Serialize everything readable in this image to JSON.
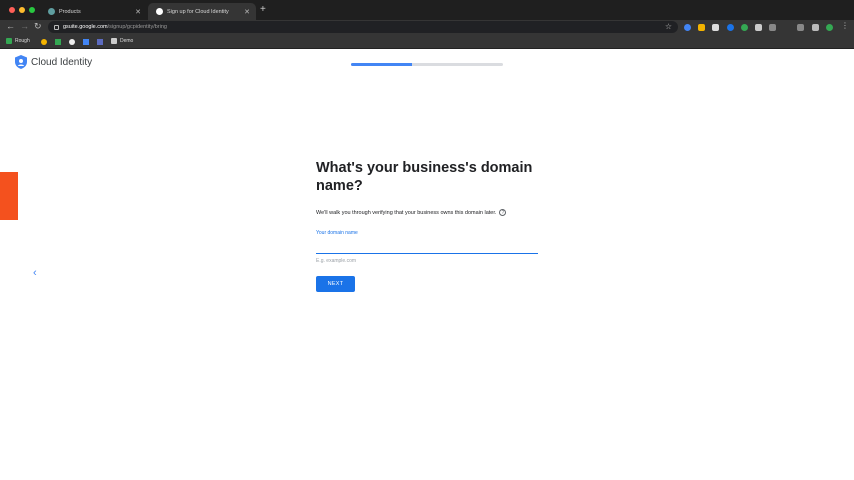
{
  "browser": {
    "tabs": [
      {
        "label": "Products",
        "active": false
      },
      {
        "label": "Sign up for Cloud Identity",
        "active": true
      }
    ],
    "url": {
      "host": "gsuite.google.com",
      "path": "/signup/gcpidentity/bring"
    },
    "bookmarks": [
      "Rough",
      "Demo"
    ]
  },
  "page": {
    "brand": "Cloud Identity",
    "progress_fraction": 0.4,
    "headline": "What's your business's domain name?",
    "description": "We'll walk you through verifying that your business owns this domain later.",
    "help_glyph": "?",
    "field_label": "Your domain name",
    "field_value": "",
    "field_hint": "E.g. example.com",
    "next_label": "NEXT",
    "back_glyph": "‹"
  },
  "colors": {
    "accent": "#1a73e8",
    "progress": "#4285f4",
    "orange_tab": "#f4511e"
  }
}
